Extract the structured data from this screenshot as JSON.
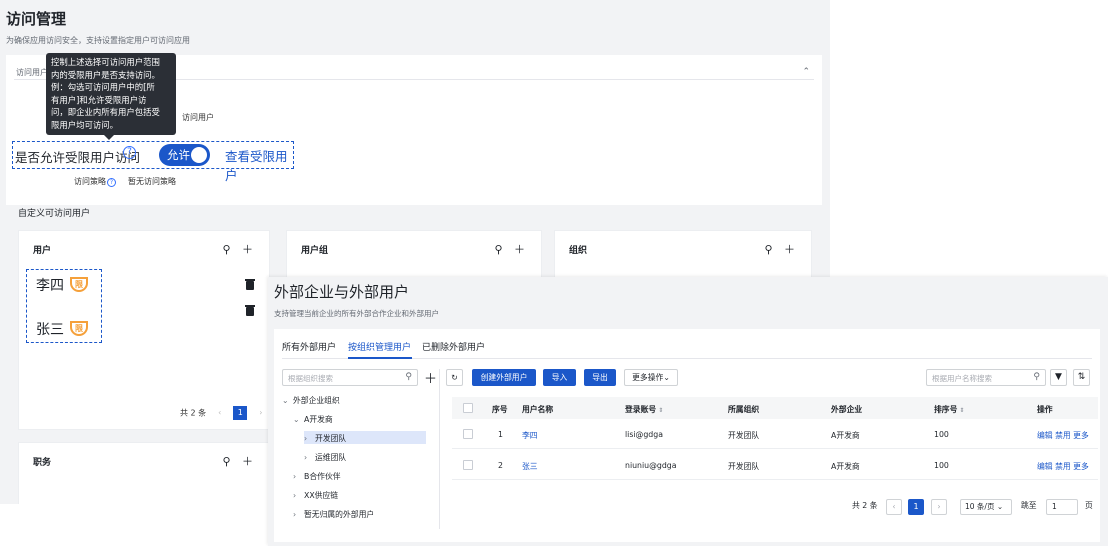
{
  "back": {
    "title": "访问管理",
    "subtitle": "为确保应用访问安全，支持设置指定用户可访问应用",
    "card_header": "访问用户",
    "collapse_icon": "chevron-up-icon",
    "tooltip": [
      "控制上述选择可访问用户范围",
      "内的受限用户是否支持访问。",
      "例：勾选可访问用户中的[所",
      "有用户]和允许受限用户访",
      "问，即企业内所有用户包括受",
      "限用户均可访问。"
    ],
    "hint_tail": "访问用户",
    "allow_label": "是否允许受限用户访问",
    "help_glyph": "?",
    "toggle_label": "允许",
    "view_restricted": "查看受限用户",
    "policy_label": "访问策略",
    "policy_help_glyph": "?",
    "policy_value": "暂无访问策略",
    "custom_title": "自定义可访问用户",
    "panels": {
      "user": "用户",
      "group": "用户组",
      "org": "组织",
      "duty": "职务",
      "icons": "⚲ ＋"
    },
    "users": [
      {
        "name": "李四",
        "badge": "限"
      },
      {
        "name": "张三",
        "badge": "限"
      }
    ],
    "pager": {
      "total": "共 2 条",
      "prev": "‹",
      "page": "1",
      "next": "›"
    }
  },
  "front": {
    "title": "外部企业与外部用户",
    "subtitle": "支持管理当前企业的所有外部合作企业和外部用户",
    "tabs": [
      "所有外部用户",
      "按组织管理用户",
      "已删除外部用户"
    ],
    "org_search_placeholder": "根据组织搜索",
    "search_glyph": "⚲",
    "add_glyph": "＋",
    "tree": [
      {
        "arrow": "⌄",
        "label": "外部企业组织"
      },
      {
        "arrow": "⌄",
        "label": "A开发商"
      },
      {
        "arrow": "›",
        "label": "开发团队"
      },
      {
        "arrow": "›",
        "label": "运维团队"
      },
      {
        "arrow": "›",
        "label": "B合作伙伴"
      },
      {
        "arrow": "›",
        "label": "XX供应链"
      },
      {
        "arrow": "›",
        "label": "暂无归属的外部用户"
      }
    ],
    "toolbar": {
      "refresh": "↻",
      "create": "创建外部用户",
      "import": "导入",
      "export": "导出",
      "more": "更多操作",
      "more_caret": "⌄",
      "user_search_placeholder": "根据用户名称搜索",
      "filter": "▼",
      "sort": "⇅"
    },
    "table": {
      "headers": [
        "序号",
        "用户名称",
        "登录账号",
        "所属组织",
        "外部企业",
        "排序号",
        "操作"
      ],
      "sort_glyph": "⇕",
      "rows": [
        {
          "no": "1",
          "name": "李四",
          "account": "lisi@gdga",
          "org": "开发团队",
          "company": "A开发商",
          "order": "100",
          "actions": "编辑 禁用 更多"
        },
        {
          "no": "2",
          "name": "张三",
          "account": "niuniu@gdga",
          "org": "开发团队",
          "company": "A开发商",
          "order": "100",
          "actions": "编辑 禁用 更多"
        }
      ]
    },
    "pager": {
      "total": "共 2 条",
      "prev": "‹",
      "page": "1",
      "next": "›",
      "page_size": "10 条/页",
      "page_size_caret": "⌄",
      "jump_label": "跳至",
      "jump_value": "1",
      "jump_unit": "页"
    }
  }
}
